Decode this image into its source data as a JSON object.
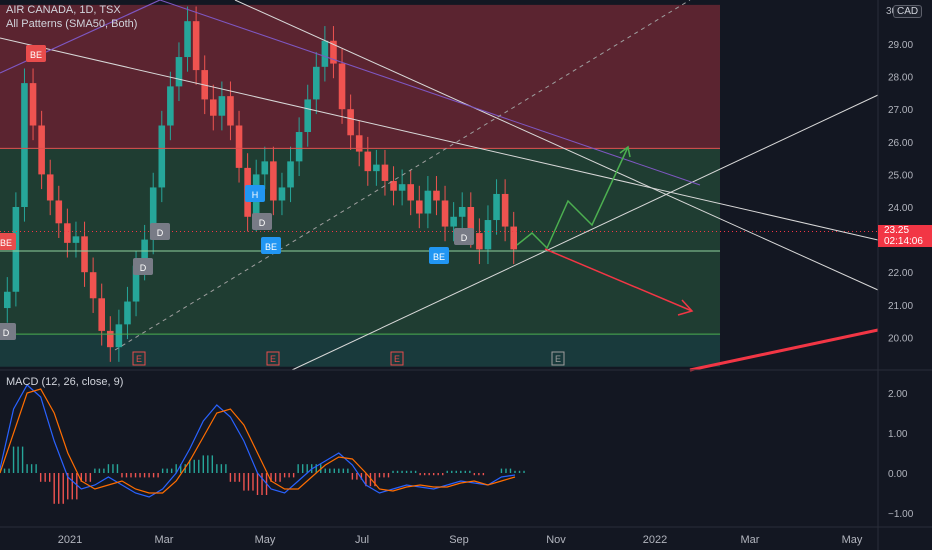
{
  "header": {
    "symbol_line": "AIR CANADA, 1D, TSX",
    "indicator_line": "All Patterns (SMA50, Both)",
    "currency_badge": "CAD",
    "macd_label": "MACD (12, 26, close, 9)"
  },
  "price_tag": {
    "price": "23.25",
    "countdown": "02:14:06",
    "color": "#f23645"
  },
  "colors": {
    "background": "#131722",
    "upper_zone": "#5b2430",
    "middle_zone": "#1f3d32",
    "lower_zone": "#193a3c",
    "candle_up": "#26a69a",
    "candle_down": "#ef5350",
    "macd_line": "#2962ff",
    "signal_line": "#ff6d00",
    "projection_up": "#4caf50",
    "projection_down": "#f23645"
  },
  "chart_data": [
    {
      "type": "candlestick",
      "title": "AIR CANADA, 1D, TSX",
      "y_axis": {
        "ticks": [
          20.0,
          21.0,
          22.0,
          23.0,
          24.0,
          25.0,
          26.0,
          27.0,
          28.0,
          29.0
        ],
        "tick_labels": [
          "20.00",
          "21.00",
          "22.00",
          "23.00",
          "24.00",
          "25.00",
          "26.00",
          "27.00",
          "28.00",
          "29.00"
        ],
        "range": [
          19.1,
          30.2
        ],
        "partial_top_label": "30"
      },
      "x_axis": {
        "labels": [
          "2021",
          "Mar",
          "May",
          "Jul",
          "Sep",
          "Nov",
          "2022",
          "Mar",
          "May"
        ]
      },
      "zones": [
        {
          "name": "upper",
          "from": 25.8,
          "to": 30.2
        },
        {
          "name": "middle",
          "from": 20.1,
          "to": 25.8
        },
        {
          "name": "lower",
          "from": 19.1,
          "to": 20.1
        }
      ],
      "horizontal_levels": [
        25.8,
        22.65,
        20.1
      ],
      "last_price": 23.25,
      "close_series": [
        21.4,
        24.0,
        27.8,
        26.5,
        25.0,
        24.2,
        23.5,
        22.9,
        23.1,
        22.0,
        21.2,
        20.2,
        19.7,
        20.4,
        21.1,
        22.2,
        23.0,
        24.6,
        26.5,
        27.7,
        28.6,
        29.7,
        28.2,
        27.3,
        26.8,
        27.4,
        26.5,
        25.2,
        23.7,
        25.0,
        25.4,
        24.2,
        24.6,
        25.4,
        26.3,
        27.3,
        28.3,
        29.1,
        28.4,
        27.0,
        26.2,
        25.7,
        25.1,
        25.3,
        24.8,
        24.5,
        24.7,
        24.2,
        23.8,
        24.5,
        24.2,
        23.4,
        23.7,
        24.0,
        23.2,
        22.7,
        23.6,
        24.4,
        23.4,
        22.7
      ],
      "patterns": [
        {
          "label": "BE",
          "color": "red"
        },
        {
          "label": "BE",
          "color": "red"
        },
        {
          "label": "D",
          "color": "gray"
        },
        {
          "label": "D",
          "color": "gray"
        },
        {
          "label": "D",
          "color": "gray"
        },
        {
          "label": "H",
          "color": "blue"
        },
        {
          "label": "D",
          "color": "gray"
        },
        {
          "label": "BE",
          "color": "blue"
        },
        {
          "label": "BE",
          "color": "blue"
        },
        {
          "label": "D",
          "color": "gray"
        }
      ],
      "earnings_markers": [
        "E",
        "E",
        "E",
        "E"
      ]
    },
    {
      "type": "line",
      "title": "MACD (12, 26, close, 9)",
      "y_axis": {
        "ticks": [
          2.0,
          1.0,
          0.0,
          -1.0
        ],
        "tick_labels": [
          "2.00",
          "1.00",
          "0.00",
          "−1.00"
        ],
        "range": [
          -1.5,
          2.5
        ]
      },
      "series": [
        {
          "name": "MACD",
          "values": [
            0.1,
            1.6,
            2.2,
            1.9,
            0.8,
            -0.1,
            -0.4,
            -0.3,
            -0.1,
            -0.3,
            -0.5,
            -0.6,
            -0.4,
            0.0,
            0.6,
            1.3,
            1.7,
            1.4,
            0.8,
            0.0,
            -0.4,
            -0.5,
            -0.2,
            0.1,
            0.3,
            0.5,
            0.2,
            -0.3,
            -0.5,
            -0.4,
            -0.3,
            -0.35,
            -0.4,
            -0.3,
            -0.2,
            -0.25,
            -0.3,
            -0.1,
            -0.05
          ]
        },
        {
          "name": "Signal",
          "values": [
            0.0,
            1.0,
            2.0,
            2.1,
            1.5,
            0.5,
            -0.2,
            -0.4,
            -0.3,
            -0.2,
            -0.4,
            -0.5,
            -0.5,
            -0.2,
            0.3,
            0.9,
            1.5,
            1.6,
            1.2,
            0.5,
            -0.2,
            -0.4,
            -0.4,
            -0.1,
            0.2,
            0.4,
            0.35,
            0.0,
            -0.4,
            -0.45,
            -0.35,
            -0.3,
            -0.35,
            -0.35,
            -0.25,
            -0.2,
            -0.3,
            -0.2,
            -0.1
          ]
        }
      ]
    }
  ]
}
